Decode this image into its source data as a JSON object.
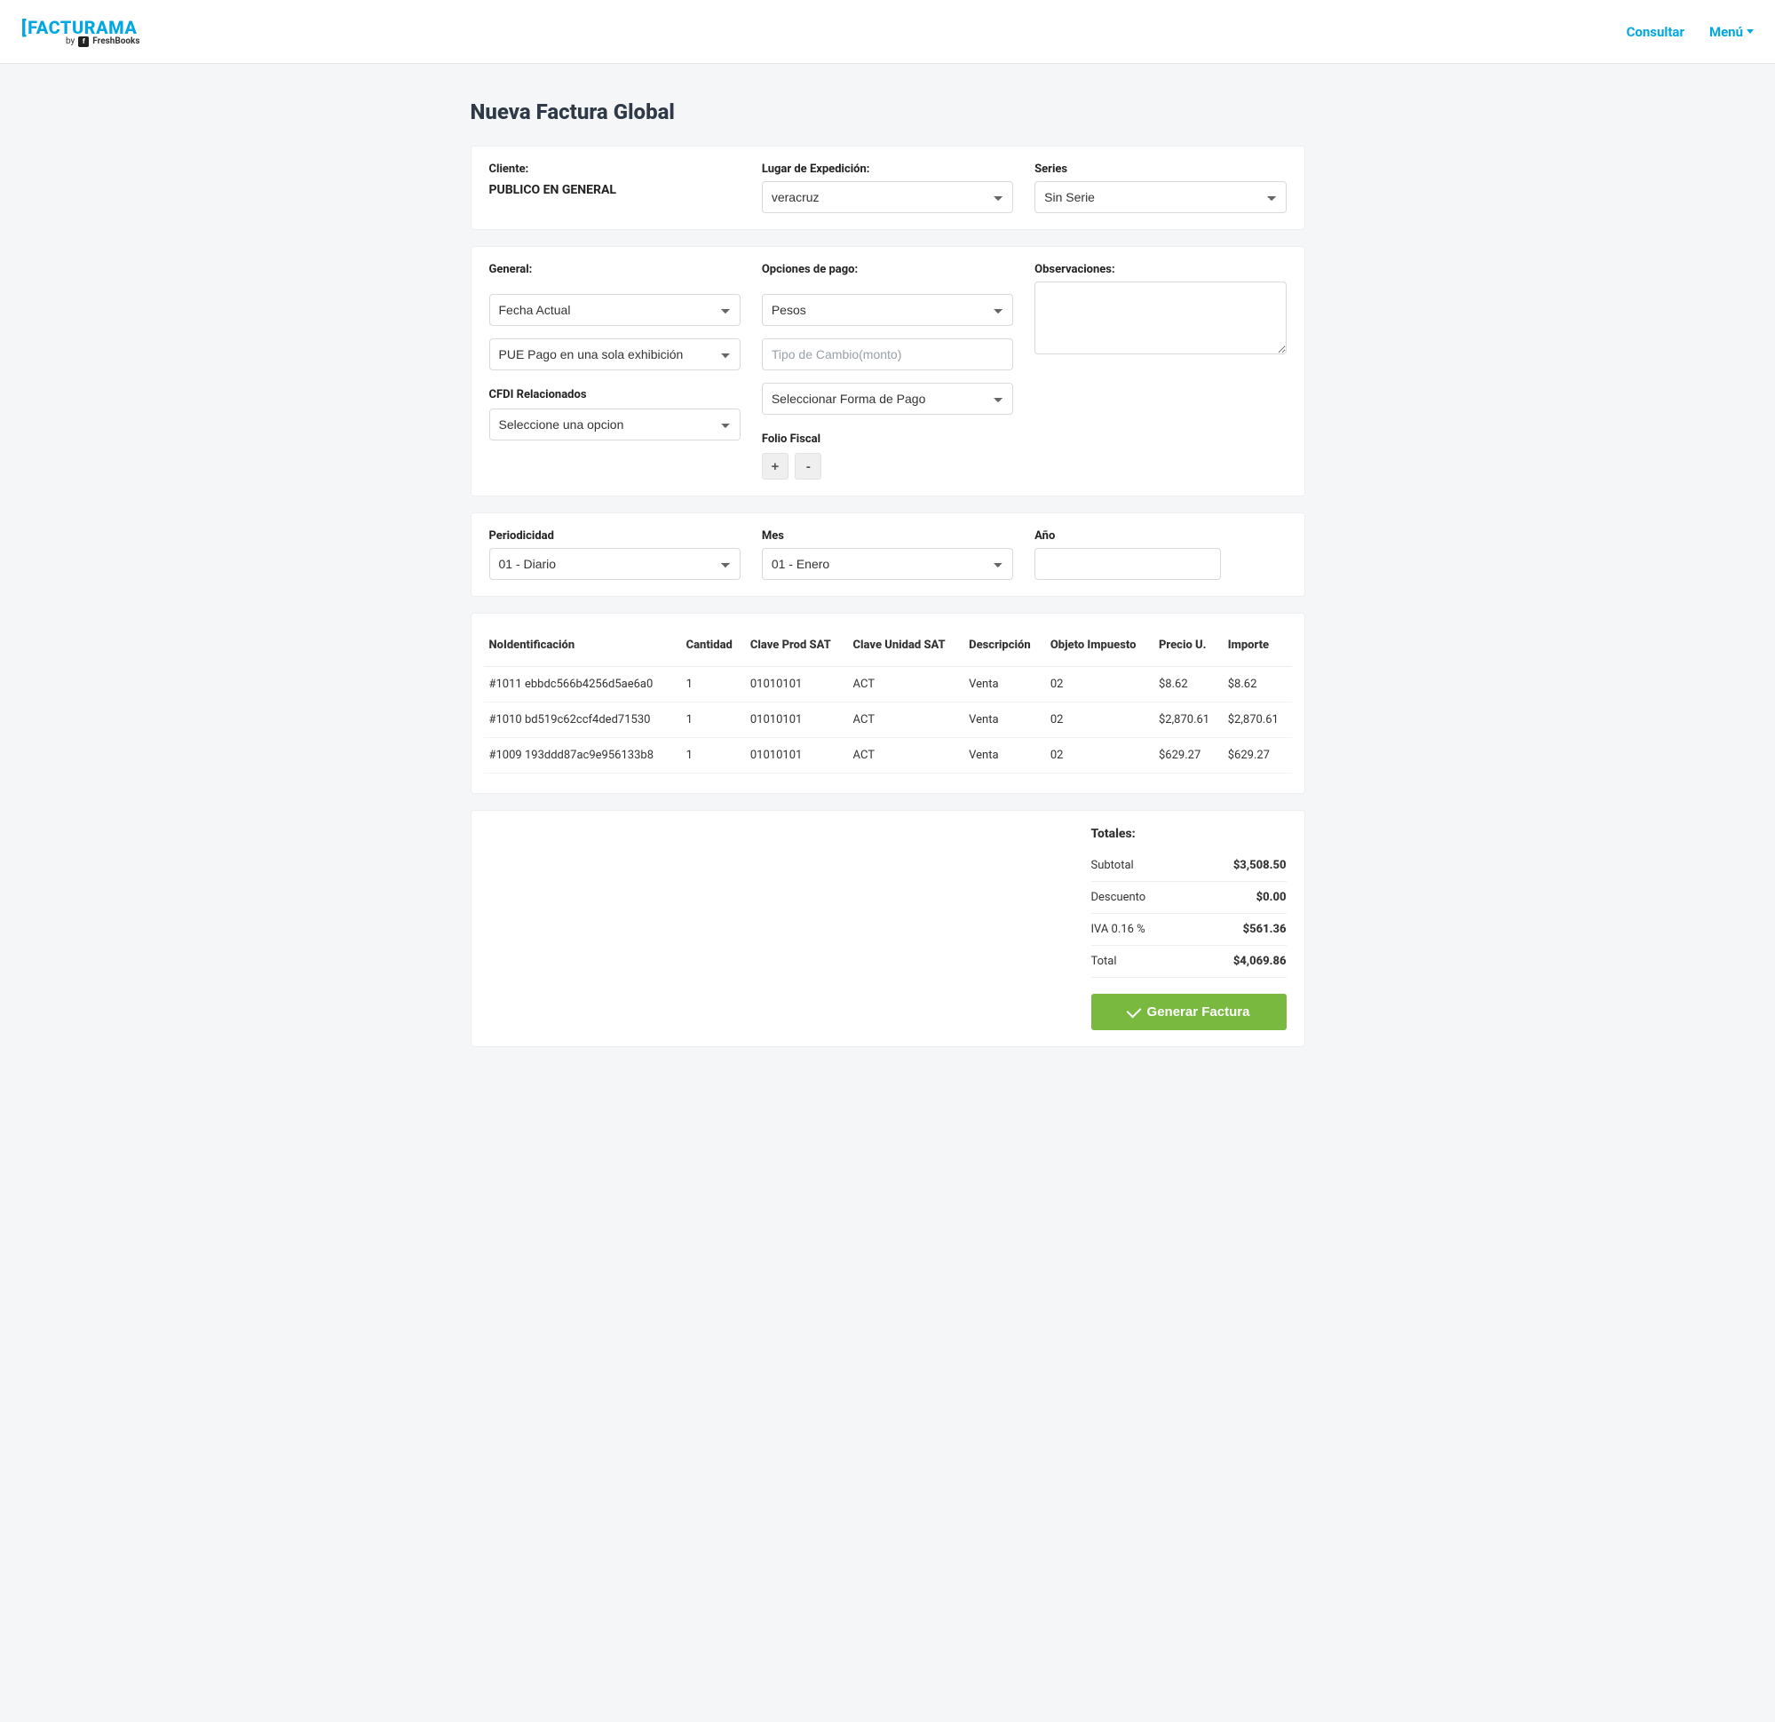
{
  "nav": {
    "logo_main": "FACTURAMA",
    "logo_sub_prefix": "by",
    "logo_sub_brand": "FreshBooks",
    "consultar": "Consultar",
    "menu": "Menú"
  },
  "page": {
    "title": "Nueva Factura Global"
  },
  "section1": {
    "cliente_label": "Cliente:",
    "cliente_value": "PUBLICO EN GENERAL",
    "lugar_label": "Lugar de Expedición:",
    "lugar_value": "veracruz",
    "series_label": "Series",
    "series_value": "Sin Serie"
  },
  "section2": {
    "general_label": "General:",
    "fecha_value": "Fecha Actual",
    "metodo_value": "PUE Pago en una sola exhibición",
    "cfdi_label": "CFDI Relacionados",
    "cfdi_value": "Seleccione una opcion",
    "pago_label": "Opciones de pago:",
    "moneda_value": "Pesos",
    "tipo_cambio_placeholder": "Tipo de Cambio(monto)",
    "forma_pago_value": "Seleccionar Forma de Pago",
    "folio_label": "Folio Fiscal",
    "folio_plus": "+",
    "folio_minus": "-",
    "obs_label": "Observaciones:",
    "obs_value": ""
  },
  "section3": {
    "periodicidad_label": "Periodicidad",
    "periodicidad_value": "01 - Diario",
    "mes_label": "Mes",
    "mes_value": "01 - Enero",
    "ano_label": "Año",
    "ano_value": ""
  },
  "items": {
    "headers": {
      "noid": "NoIdentificación",
      "cantidad": "Cantidad",
      "clave_prod": "Clave Prod SAT",
      "clave_unidad": "Clave Unidad SAT",
      "descripcion": "Descripción",
      "objeto": "Objeto Impuesto",
      "precio": "Precio U.",
      "importe": "Importe"
    },
    "rows": [
      {
        "noid": "#1011 ebbdc566b4256d5ae6a0",
        "cantidad": "1",
        "clave_prod": "01010101",
        "clave_unidad": "ACT",
        "descripcion": "Venta",
        "objeto": "02",
        "precio": "$8.62",
        "importe": "$8.62"
      },
      {
        "noid": "#1010 bd519c62ccf4ded71530",
        "cantidad": "1",
        "clave_prod": "01010101",
        "clave_unidad": "ACT",
        "descripcion": "Venta",
        "objeto": "02",
        "precio": "$2,870.61",
        "importe": "$2,870.61"
      },
      {
        "noid": "#1009 193ddd87ac9e956133b8",
        "cantidad": "1",
        "clave_prod": "01010101",
        "clave_unidad": "ACT",
        "descripcion": "Venta",
        "objeto": "02",
        "precio": "$629.27",
        "importe": "$629.27"
      }
    ]
  },
  "totals": {
    "title": "Totales:",
    "subtotal_k": "Subtotal",
    "subtotal_v": "$3,508.50",
    "descuento_k": "Descuento",
    "descuento_v": "$0.00",
    "iva_k": "IVA 0.16 %",
    "iva_v": "$561.36",
    "total_k": "Total",
    "total_v": "$4,069.86",
    "generate_btn": "Generar Factura"
  }
}
